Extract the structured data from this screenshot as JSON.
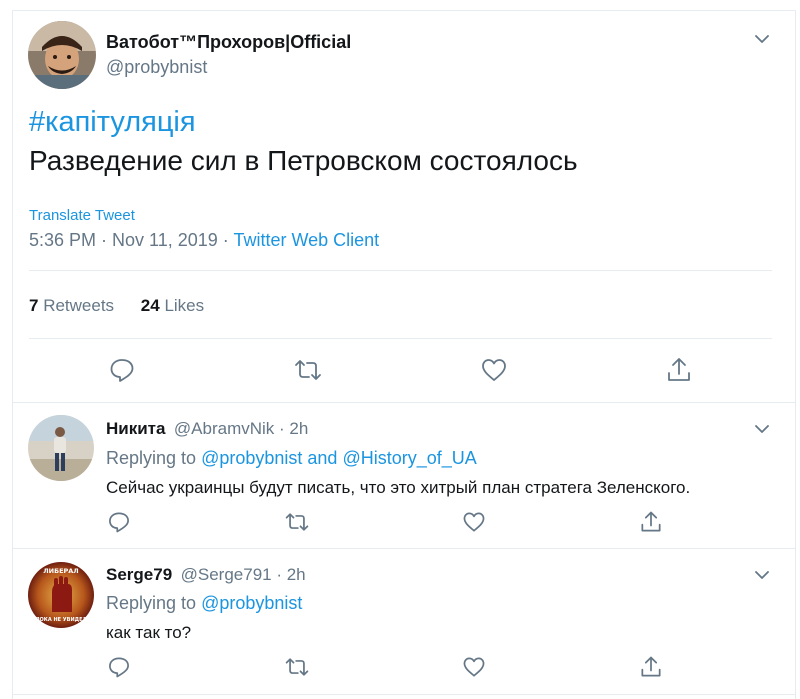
{
  "main_tweet": {
    "display_name": "Ватобот™Прохоров|Official",
    "handle": "@probybnist",
    "hashtag": "#капітуляція",
    "text": "Разведение сил в Петровском состоялось",
    "translate": "Translate Tweet",
    "timestamp": "5:36 PM · Nov 11, 2019 · ",
    "client": "Twitter Web Client",
    "retweets_count": "7",
    "retweets_label": " Retweets",
    "likes_count": "24",
    "likes_label": " Likes"
  },
  "replies": [
    {
      "display_name": "Никита",
      "handle": "@AbramvNik · 2h",
      "replying_prefix": "Replying to ",
      "replying_to_1": "@probybnist",
      "replying_join": " and ",
      "replying_to_2": "@History_of_UA",
      "text": "Сейчас украинцы будут писать, что это хитрый план стратега Зеленского."
    },
    {
      "display_name": "Serge79",
      "handle": "@Serge791 · 2h",
      "replying_prefix": "Replying to ",
      "replying_to_1": "@probybnist",
      "text": "как так то?",
      "avatar_text_top": "ЛИБЕРАЛ",
      "avatar_text_bottom": "ПОКА НЕ УВИДЕЛ"
    }
  ],
  "colors": {
    "accent": "#1b95e0",
    "secondary": "#657786",
    "divider": "#e6ecf0"
  },
  "icons": [
    "chevron-down-icon",
    "reply-icon",
    "retweet-icon",
    "like-icon",
    "share-icon"
  ]
}
